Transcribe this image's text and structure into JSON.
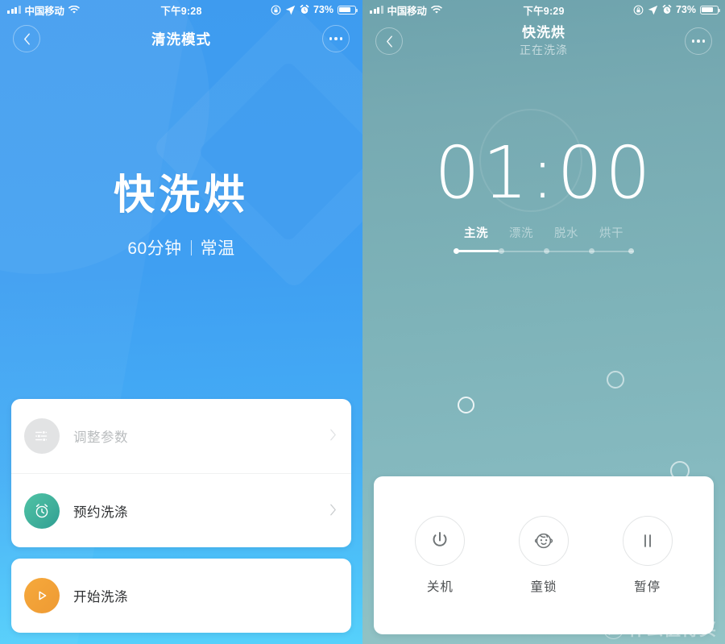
{
  "colors": {
    "left_bg_top": "#3E9BEF",
    "left_bg_bottom": "#56D1FB",
    "right_bg_top": "#6EA3AD",
    "right_bg_bottom": "#93C4C6",
    "accent_green": "#3FAE9A",
    "accent_orange": "#F09B34",
    "card_white": "#FFFFFF"
  },
  "left": {
    "status_bar": {
      "carrier": "中国移动",
      "time": "下午9:28",
      "battery_percent": "73%",
      "icons": [
        "signal-bars-icon",
        "wifi-icon",
        "rotation-lock-icon",
        "location-arrow-icon",
        "alarm-clock-icon",
        "battery-icon"
      ]
    },
    "nav": {
      "back_icon": "chevron-left-icon",
      "title": "清洗模式",
      "more_icon": "more-dots-icon"
    },
    "hero": {
      "title": "快洗烘",
      "duration": "60分钟",
      "temperature": "常温"
    },
    "rows": [
      {
        "icon": "sliders-icon",
        "label": "调整参数",
        "chevron": "chevron-right-icon",
        "state": "disabled"
      },
      {
        "icon": "alarm-clock-icon",
        "label": "预约洗涤",
        "chevron": "chevron-right-icon",
        "state": "enabled"
      }
    ],
    "primary_action": {
      "icon": "play-icon",
      "label": "开始洗涤",
      "chevron": "chevron-right-icon"
    }
  },
  "right": {
    "status_bar": {
      "carrier": "中国移动",
      "time": "下午9:29",
      "battery_percent": "73%",
      "icons": [
        "signal-bars-icon",
        "wifi-icon",
        "rotation-lock-icon",
        "location-arrow-icon",
        "alarm-clock-icon",
        "battery-icon"
      ]
    },
    "nav": {
      "back_icon": "chevron-left-icon",
      "title": "快洗烘",
      "subtitle": "正在洗涤",
      "more_icon": "more-dots-icon"
    },
    "timer": "01:00",
    "stages": [
      {
        "label": "主洗",
        "active": true
      },
      {
        "label": "漂洗",
        "active": false
      },
      {
        "label": "脱水",
        "active": false
      },
      {
        "label": "烘干",
        "active": false
      }
    ],
    "controls": [
      {
        "icon": "power-icon",
        "label": "关机"
      },
      {
        "icon": "child-lock-icon",
        "label": "童锁"
      },
      {
        "icon": "pause-icon",
        "label": "暂停"
      }
    ]
  },
  "watermark": {
    "badge": "值",
    "text": "什么值得买"
  }
}
